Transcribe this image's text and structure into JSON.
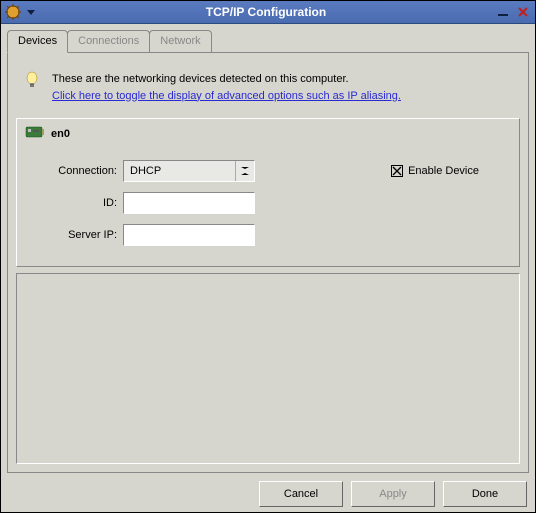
{
  "window": {
    "title": "TCP/IP Configuration"
  },
  "tabs": [
    {
      "label": "Devices"
    },
    {
      "label": "Connections"
    },
    {
      "label": "Network"
    }
  ],
  "hint": {
    "line1": "These are the networking devices detected on this computer.",
    "link": "Click here to toggle the display of advanced options such as IP aliasing."
  },
  "device": {
    "name": "en0"
  },
  "form": {
    "connection_label": "Connection:",
    "connection_value": "DHCP",
    "id_label": "ID:",
    "id_value": "",
    "server_ip_label": "Server IP:",
    "server_ip_value": "",
    "enable_label": "Enable Device",
    "enable_checked": true
  },
  "buttons": {
    "cancel": "Cancel",
    "apply": "Apply",
    "done": "Done"
  }
}
